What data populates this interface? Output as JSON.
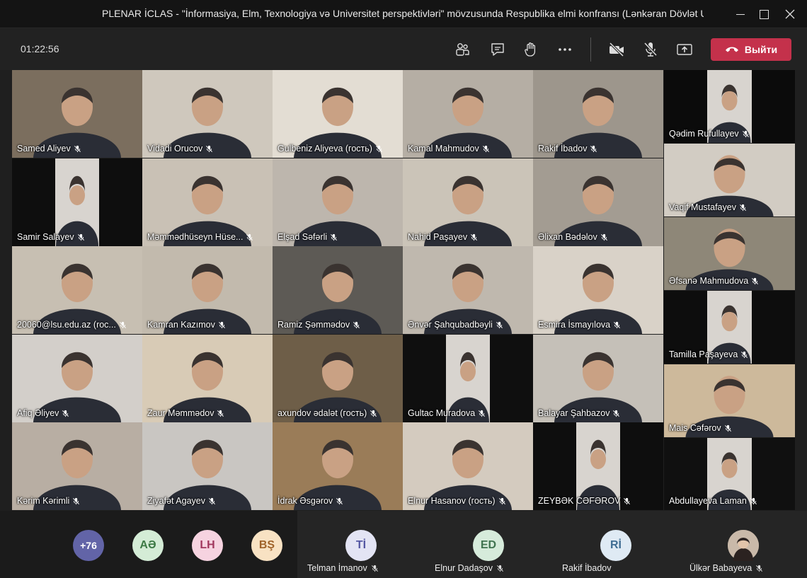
{
  "window": {
    "title": "PLENAR İCLAS - \"İnformasiya, Elm, Texnologiya və Universitet perspektivləri\" mövzusunda Respublika elmi konfransı (Lənkəran Dövlət U..."
  },
  "toolbar": {
    "timer": "01:22:56",
    "leave_label": "Выйти",
    "leave_color": "#c4314b"
  },
  "tiles": [
    {
      "name": "Samed Aliyev",
      "bg": "#7b6e5e"
    },
    {
      "name": "Vidadi Orucov",
      "bg": "#cfc8bd"
    },
    {
      "name": "Gulbeniz Aliyeva (гость)",
      "bg": "#e3ddd3"
    },
    {
      "name": "Kamal Mahmudov",
      "bg": "#b5aea4"
    },
    {
      "name": "Rakif İbadov",
      "bg": "#9d968c"
    },
    {
      "name": "Qədim Rufullayev",
      "bg": "#0b0b0b"
    },
    {
      "name": "Samir Salayev",
      "bg": "#0e0e0e"
    },
    {
      "name": "Məmmədhüseyn Hüse...",
      "bg": "#c9c1b5"
    },
    {
      "name": "Elşad Səfərli",
      "bg": "#bdb6ad"
    },
    {
      "name": "Nahid Paşayev",
      "bg": "#cbc4b8"
    },
    {
      "name": "Əlixan Bədəlov",
      "bg": "#a39c92"
    },
    {
      "name": "Vaqif Mustafayev",
      "bg": "#d2ccc3"
    },
    {
      "name": "20060@lsu.edu.az (roc...",
      "bg": "#c7bfb2"
    },
    {
      "name": "Kamran Kazımov",
      "bg": "#c2baad"
    },
    {
      "name": "Ramiz Şəmmədov",
      "bg": "#5d5a55"
    },
    {
      "name": "Əfsanə Mahmudova",
      "bg": "#8e8778"
    },
    {
      "name": "Ənvər Şahqubadbəyli",
      "bg": "#bfb8ae"
    },
    {
      "name": "Esmira İsmayılova",
      "bg": "#d9d2c8"
    },
    {
      "name": "Tamilla Paşayeva",
      "bg": "#0d0d0d"
    },
    {
      "name": "Afiq Əliyev",
      "bg": "#d3cfca"
    },
    {
      "name": "Zaur Məmmədov",
      "bg": "#d8cbb6"
    },
    {
      "name": "axundov ədalət (гость)",
      "bg": "#6e5e48"
    },
    {
      "name": "Gultac Muradova",
      "bg": "#0f0f0f"
    },
    {
      "name": "Balayar Şahbazov",
      "bg": "#c5c0b8"
    },
    {
      "name": "Mais Cəfərov",
      "bg": "#cdb99b"
    },
    {
      "name": "Kərim Kərimli",
      "bg": "#b8aea3"
    },
    {
      "name": "Ziyafət Agayev",
      "bg": "#c9c6c2"
    },
    {
      "name": "İdrak Əsgərov",
      "bg": "#9a7c58"
    },
    {
      "name": "Elnur Hasanov (гость)",
      "bg": "#d4cbbf"
    },
    {
      "name": "ZEYBƏK CƏFƏROV",
      "bg": "#0e0e0e"
    },
    {
      "name": "Abdullayeva Laman",
      "bg": "#101010"
    }
  ],
  "roster": {
    "more_count": "+76",
    "initials": [
      {
        "text": "AƏ",
        "bg": "#d4ecd6",
        "fg": "#3d7a45"
      },
      {
        "text": "LH",
        "bg": "#f6d3e0",
        "fg": "#a1385e"
      },
      {
        "text": "BŞ",
        "bg": "#f8e2c3",
        "fg": "#a0632a"
      }
    ],
    "more_bg": "#6264a7",
    "people": [
      {
        "initials": "Tİ",
        "name": "Telman İmanov",
        "bg": "#e3e4f4",
        "fg": "#5558a3"
      },
      {
        "initials": "ED",
        "name": "Elnur Dadaşov",
        "bg": "#d6ebdb",
        "fg": "#417451"
      },
      {
        "initials": "Rİ",
        "name": "Rakif İbadov",
        "bg": "#dfeaf4",
        "fg": "#3f6d93"
      },
      {
        "initials": "",
        "name": "Ülkər Babayeva",
        "bg": "#c9b9a9",
        "fg": "#333"
      }
    ]
  }
}
